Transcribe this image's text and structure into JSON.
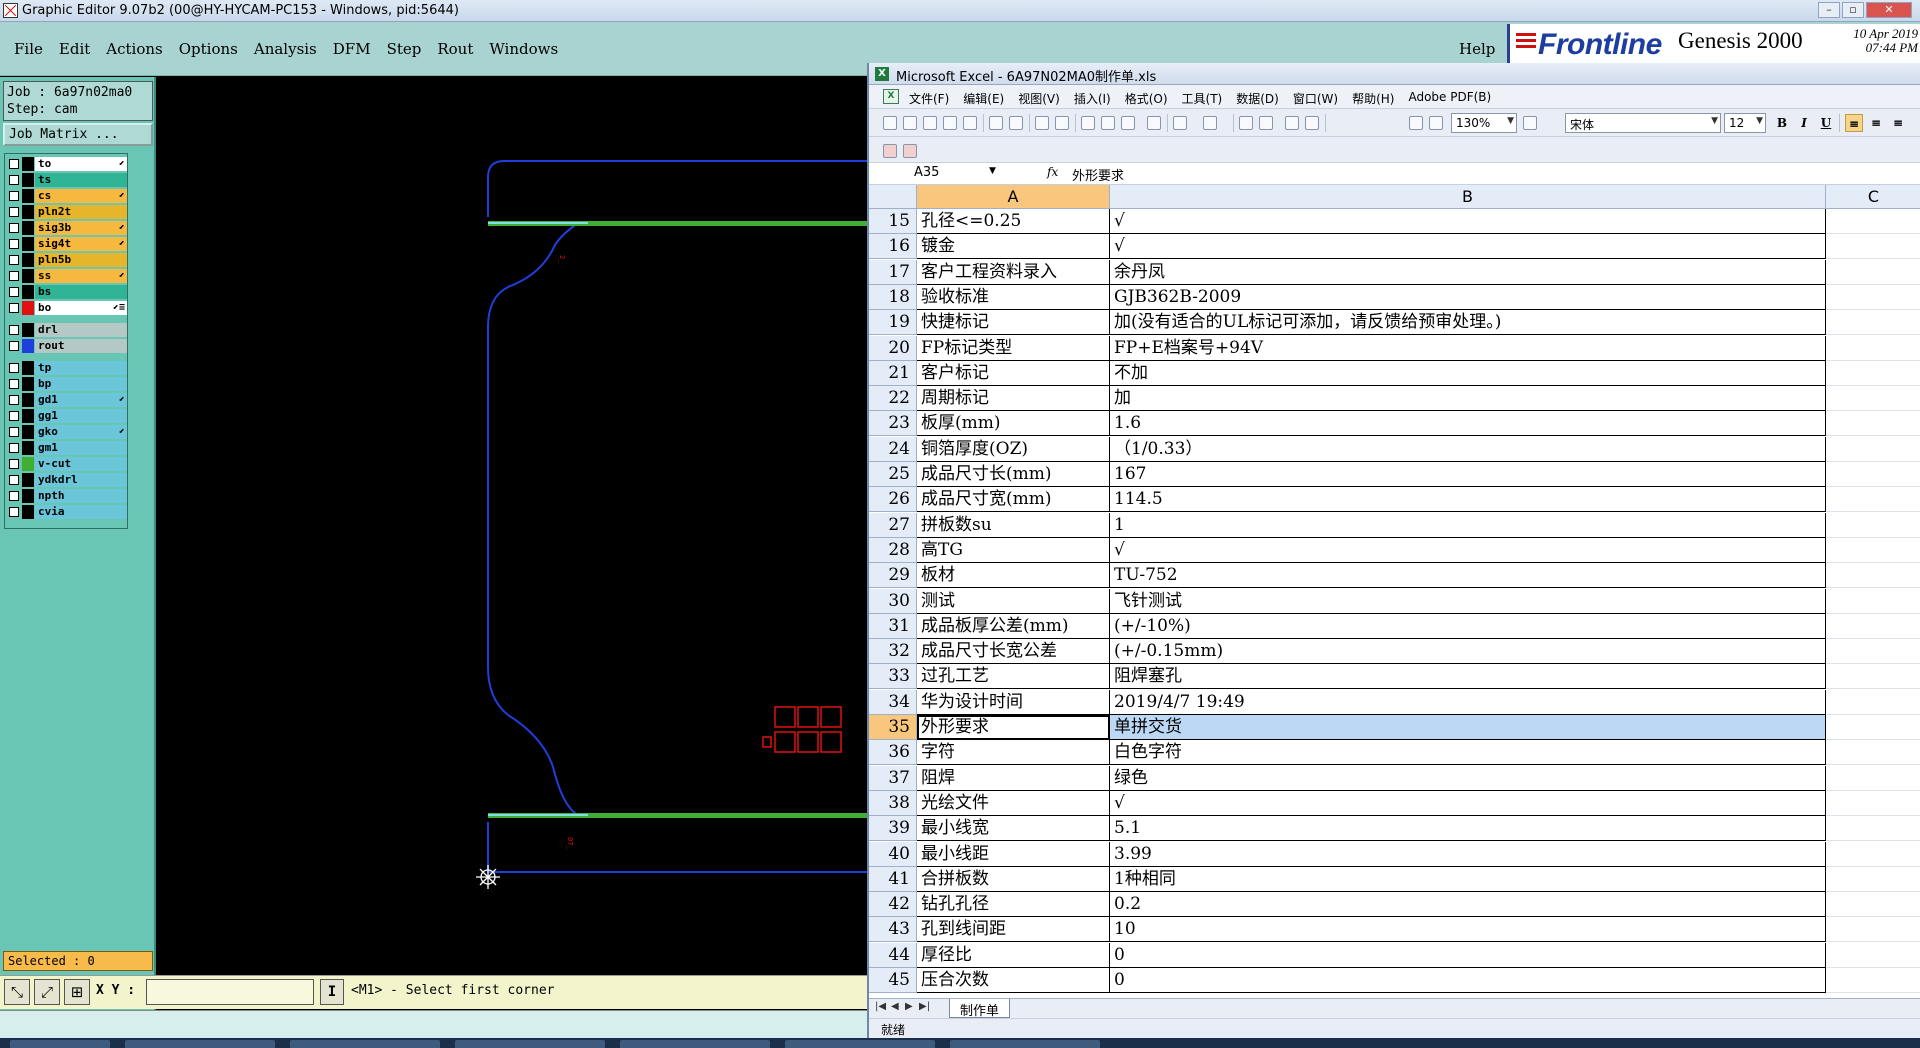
{
  "ge": {
    "title": "Graphic Editor 9.07b2 (00@HY-HYCAM-PC153 - Windows, pid:5644)",
    "menu": [
      "File",
      "Edit",
      "Actions",
      "Options",
      "Analysis",
      "DFM",
      "Step",
      "Rout",
      "Windows"
    ],
    "help": "Help",
    "brand": {
      "logo": "Frontline",
      "product": "Genesis 2000",
      "date": "10 Apr 2019",
      "time": "07:44 PM"
    },
    "job": "Job : 6a97n02ma0",
    "step": "Step: cam",
    "job_matrix": "Job Matrix ...",
    "layers": [
      {
        "name": "to",
        "color": "#ffffff",
        "swatch": "#000000",
        "flag": "⬋"
      },
      {
        "name": "ts",
        "color": "#2fb596",
        "swatch": "#000000",
        "flag": ""
      },
      {
        "name": "cs",
        "color": "#f5b93f",
        "swatch": "#000000",
        "flag": "⬋"
      },
      {
        "name": "pln2t",
        "color": "#e7b52a",
        "swatch": "#000000",
        "flag": ""
      },
      {
        "name": "sig3b",
        "color": "#f5b93f",
        "swatch": "#000000",
        "flag": "⬋"
      },
      {
        "name": "sig4t",
        "color": "#f5b93f",
        "swatch": "#000000",
        "flag": "⬋"
      },
      {
        "name": "pln5b",
        "color": "#e7b52a",
        "swatch": "#000000",
        "flag": ""
      },
      {
        "name": "ss",
        "color": "#f5b93f",
        "swatch": "#000000",
        "flag": "⬋"
      },
      {
        "name": "bs",
        "color": "#2fb596",
        "swatch": "#000000",
        "flag": ""
      },
      {
        "name": "bo",
        "color": "#ffffff",
        "swatch": "#e01010",
        "flag": "⬋≡"
      },
      {
        "name": "drl",
        "color": "#b4c8c6",
        "swatch": "#000000",
        "flag": "",
        "gap": true
      },
      {
        "name": "rout",
        "color": "#b4c8c6",
        "swatch": "#1f3fdc",
        "flag": ""
      },
      {
        "name": "tp",
        "color": "#6ac6d8",
        "swatch": "#000000",
        "flag": "",
        "gap": true
      },
      {
        "name": "bp",
        "color": "#6ac6d8",
        "swatch": "#000000",
        "flag": ""
      },
      {
        "name": "gd1",
        "color": "#6ac6d8",
        "swatch": "#000000",
        "flag": "⬋"
      },
      {
        "name": "gg1",
        "color": "#6ac6d8",
        "swatch": "#000000",
        "flag": ""
      },
      {
        "name": "gko",
        "color": "#6ac6d8",
        "swatch": "#000000",
        "flag": "⬋"
      },
      {
        "name": "gm1",
        "color": "#6ac6d8",
        "swatch": "#000000",
        "flag": ""
      },
      {
        "name": "v-cut",
        "color": "#6ac6d8",
        "swatch": "#3fae33",
        "flag": ""
      },
      {
        "name": "ydkdrl",
        "color": "#6ac6d8",
        "swatch": "#000000",
        "flag": ""
      },
      {
        "name": "npth",
        "color": "#6ac6d8",
        "swatch": "#000000",
        "flag": ""
      },
      {
        "name": "cvia",
        "color": "#6ac6d8",
        "swatch": "#000000",
        "flag": ""
      }
    ],
    "selected": "Selected : 0",
    "xy_label": "X Y :",
    "xy_value": "",
    "cursor_btn": "I",
    "prompt": "<M1> - Select first corner"
  },
  "xl": {
    "title": "Microsoft Excel - 6A97N02MA0制作单.xls",
    "menu": [
      "文件(F)",
      "编辑(E)",
      "视图(V)",
      "插入(I)",
      "格式(O)",
      "工具(T)",
      "数据(D)",
      "窗口(W)",
      "帮助(H)",
      "Adobe PDF(B)"
    ],
    "zoom": "130%",
    "font": "宋体",
    "font_size": "12",
    "name_box": "A35",
    "fx": "fx",
    "formula": "外形要求",
    "columns": [
      "A",
      "B",
      "C"
    ],
    "rows": [
      {
        "n": "15",
        "a": "孔径<=0.25",
        "b": "√"
      },
      {
        "n": "16",
        "a": "镀金",
        "b": "√"
      },
      {
        "n": "17",
        "a": "客户工程资料录入",
        "b": "余丹凤"
      },
      {
        "n": "18",
        "a": "验收标准",
        "b": "GJB362B-2009"
      },
      {
        "n": "19",
        "a": "快捷标记",
        "b": "加(没有适合的UL标记可添加，请反馈给预审处理。)"
      },
      {
        "n": "20",
        "a": "FP标记类型",
        "b": "FP+E档案号+94V"
      },
      {
        "n": "21",
        "a": "客户标记",
        "b": "不加"
      },
      {
        "n": "22",
        "a": "周期标记",
        "b": "加"
      },
      {
        "n": "23",
        "a": "板厚(mm)",
        "b": "1.6"
      },
      {
        "n": "24",
        "a": "铜箔厚度(OZ)",
        "b": "（1/0.33）"
      },
      {
        "n": "25",
        "a": "成品尺寸长(mm)",
        "b": "167"
      },
      {
        "n": "26",
        "a": "成品尺寸宽(mm)",
        "b": "114.5"
      },
      {
        "n": "27",
        "a": "拼板数su",
        "b": "1"
      },
      {
        "n": "28",
        "a": "高TG",
        "b": "√"
      },
      {
        "n": "29",
        "a": "板材",
        "b": "TU-752"
      },
      {
        "n": "30",
        "a": "测试",
        "b": "飞针测试"
      },
      {
        "n": "31",
        "a": "成品板厚公差(mm)",
        "b": "(+/-10%)"
      },
      {
        "n": "32",
        "a": "成品尺寸长宽公差",
        "b": "(+/-0.15mm)"
      },
      {
        "n": "33",
        "a": "过孔工艺",
        "b": "阻焊塞孔"
      },
      {
        "n": "34",
        "a": "华为设计时间",
        "b": "2019/4/7 19:49"
      },
      {
        "n": "35",
        "a": "外形要求",
        "b": "单拼交货",
        "active": true
      },
      {
        "n": "36",
        "a": "字符",
        "b": "白色字符"
      },
      {
        "n": "37",
        "a": "阻焊",
        "b": "绿色"
      },
      {
        "n": "38",
        "a": "光绘文件",
        "b": "√"
      },
      {
        "n": "39",
        "a": "最小线宽",
        "b": "5.1"
      },
      {
        "n": "40",
        "a": "最小线距",
        "b": "3.99"
      },
      {
        "n": "41",
        "a": "合拼板数",
        "b": "1种相同"
      },
      {
        "n": "42",
        "a": "钻孔孔径",
        "b": "0.2"
      },
      {
        "n": "43",
        "a": "孔到线间距",
        "b": "10"
      },
      {
        "n": "44",
        "a": "厚径比",
        "b": "0"
      },
      {
        "n": "45",
        "a": "压合次数",
        "b": "0"
      }
    ],
    "sheet_tab": "制作单",
    "status": "就绪"
  },
  "colors": {
    "ge_panel": "#6ac6b4",
    "ge_menubar": "#a9d3d0",
    "outline_blue": "#1f3fdc",
    "fill_green": "#3fae33",
    "marker_red": "#e01010"
  }
}
